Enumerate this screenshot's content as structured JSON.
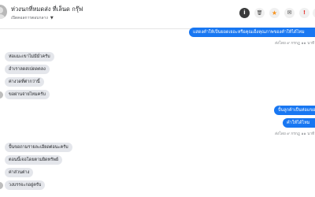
{
  "header": {
    "title": "ห่วงนกที่หมดส่ง ที่เล็นด กรุ๊ฟ",
    "subtitle": "เปิดคอลการตอบกลาง",
    "caret": "▼",
    "buttons": [
      {
        "name": "info",
        "glyph": "i"
      },
      {
        "name": "delete",
        "glyph": "🗑"
      },
      {
        "name": "star",
        "glyph": "★"
      },
      {
        "name": "mail",
        "glyph": "✉"
      },
      {
        "name": "report",
        "glyph": "!"
      },
      {
        "name": "more",
        "glyph": "⋯"
      }
    ],
    "accent": "#1877f2",
    "star_color": "#f7931e",
    "report_color": "#e53935"
  },
  "messages": {
    "out1": "แสดงคำให้เป็นยอดเยอะหรือคุณเอ็งคุณภาพของคำให้ได้ไหม",
    "ts1": "ส่งโดย ๙ กรกฎ ๑๑ นาที",
    "in1": "ห่อแมะเขาไม่มีมั่วครับ",
    "in2": "อำเราลดสเปดดตลง",
    "in3": "ค่างวดที่ต่ากว่านี้",
    "in4": "ขอผ่านจ่ายไหมครับ",
    "out2": "ปั้นลูกค้าเป็นห่อแขอ",
    "out3": "คำให้ได้ไหม",
    "ts2": "ส่งโดย ๙ กรกฎ ๑๑ นาที",
    "in5": "ปั้นขอถามรายละเอียดต่อนะครับ",
    "in6": "ตอนนี้เจอโดยตามยิดทรัพย์",
    "in7": "ค่าส่วนต่าง",
    "in8": "วงบรรจะกอยู่ครับ"
  }
}
